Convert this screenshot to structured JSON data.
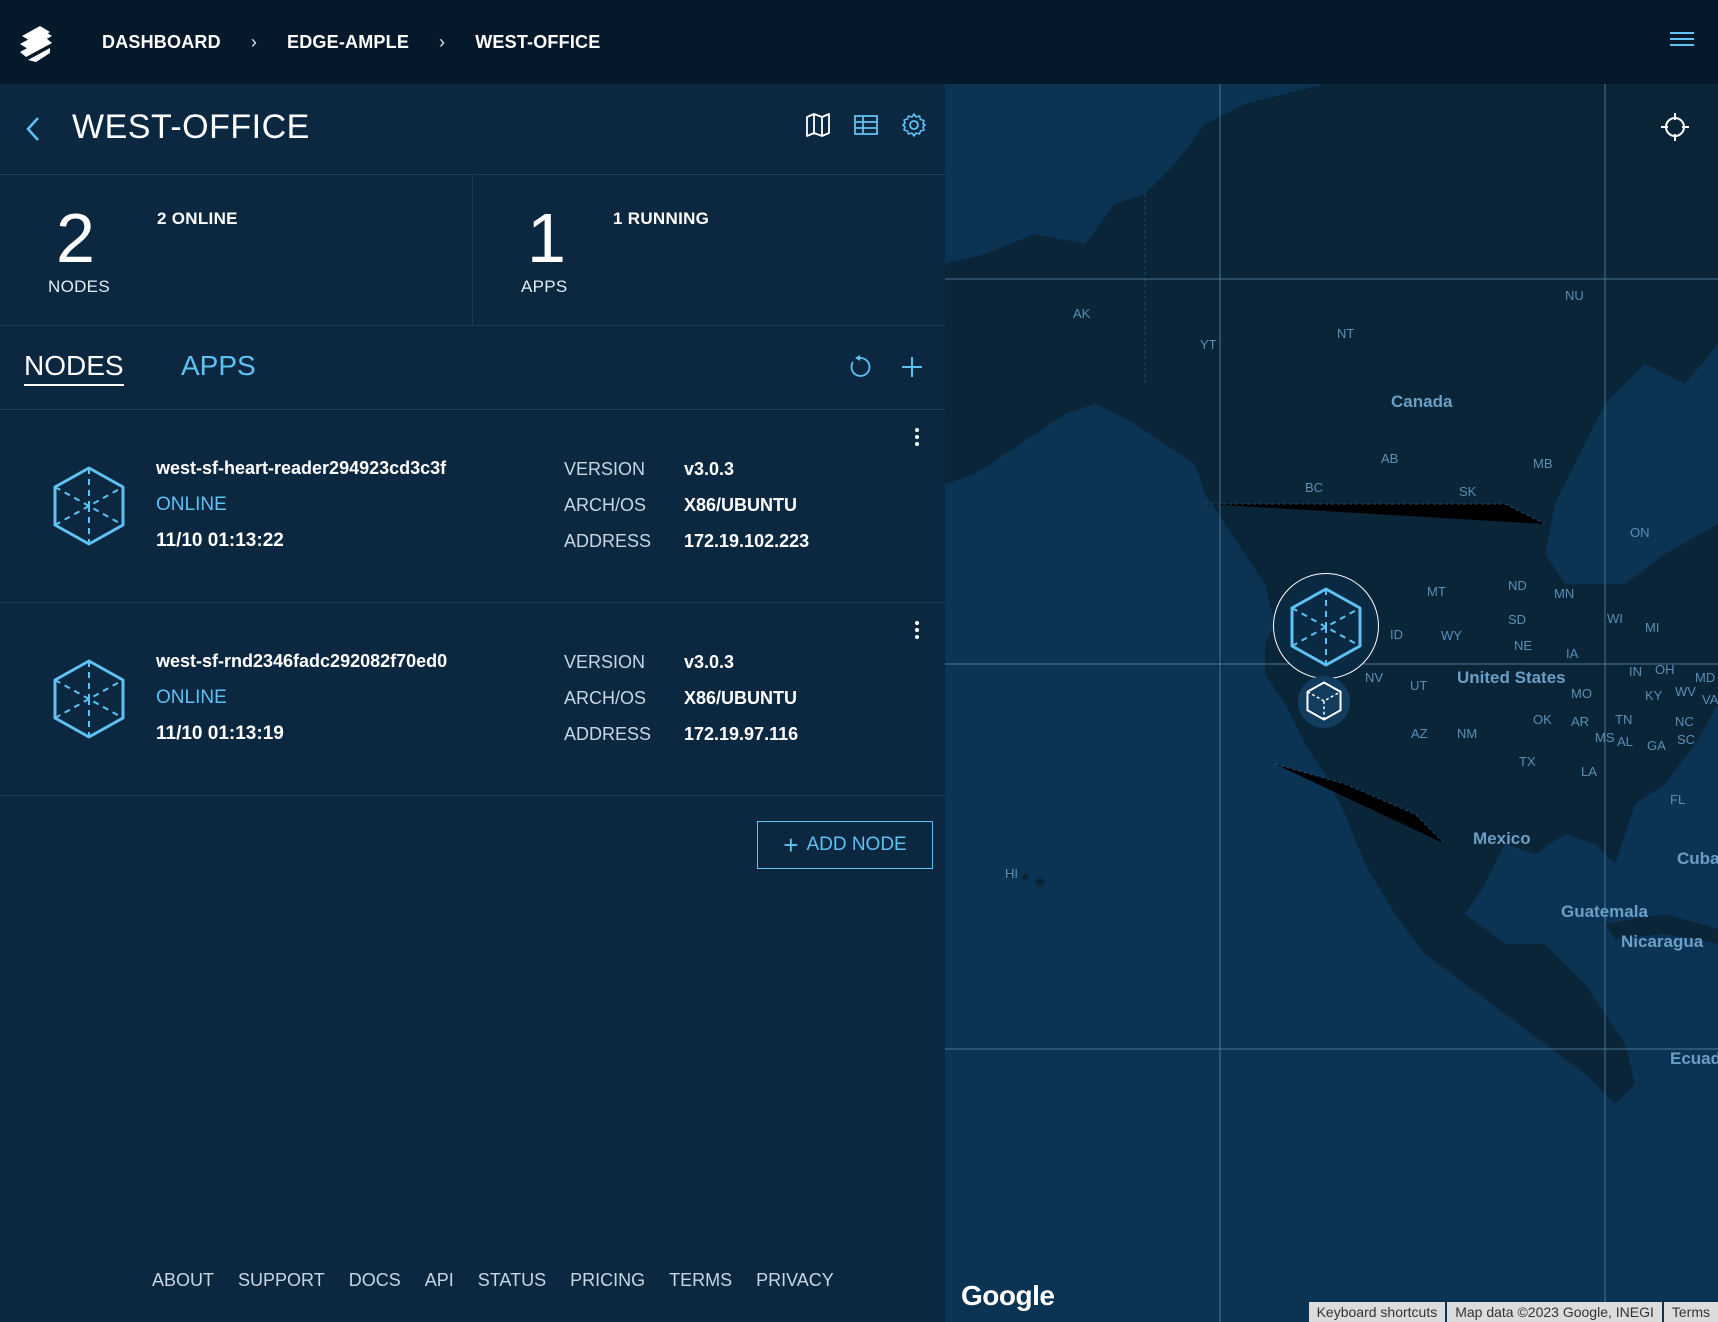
{
  "breadcrumb": [
    "DASHBOARD",
    "EDGE-AMPLE",
    "WEST-OFFICE"
  ],
  "header": {
    "title": "WEST-OFFICE"
  },
  "stats": {
    "nodes": {
      "count": "2",
      "label": "NODES",
      "sub": "2 ONLINE"
    },
    "apps": {
      "count": "1",
      "label": "APPS",
      "sub": "1 RUNNING"
    }
  },
  "tabs": {
    "nodes": "NODES",
    "apps": "APPS"
  },
  "nodes": [
    {
      "name": "west-sf-heart-reader294923cd3c3f",
      "status": "ONLINE",
      "time": "11/10 01:13:22",
      "version_label": "VERSION",
      "version": "v3.0.3",
      "arch_label": "ARCH/OS",
      "arch": "X86/UBUNTU",
      "address_label": "ADDRESS",
      "address": "172.19.102.223"
    },
    {
      "name": "west-sf-rnd2346fadc292082f70ed0",
      "status": "ONLINE",
      "time": "11/10 01:13:19",
      "version_label": "VERSION",
      "version": "v3.0.3",
      "arch_label": "ARCH/OS",
      "arch": "X86/UBUNTU",
      "address_label": "ADDRESS",
      "address": "172.19.97.116"
    }
  ],
  "add_node": "ADD NODE",
  "footer": [
    "ABOUT",
    "SUPPORT",
    "DOCS",
    "API",
    "STATUS",
    "PRICING",
    "TERMS",
    "PRIVACY"
  ],
  "map": {
    "labels": {
      "canada": "Canada",
      "us": "United States",
      "mexico": "Mexico",
      "cuba": "Cuba",
      "guatemala": "Guatemala",
      "nicaragua": "Nicaragua",
      "ecuador": "Ecuad",
      "ak": "AK",
      "yt": "YT",
      "nt": "NT",
      "nu": "NU",
      "bc": "BC",
      "ab": "AB",
      "sk": "SK",
      "mb": "MB",
      "on": "ON",
      "mt": "MT",
      "nd": "ND",
      "mn": "MN",
      "wi": "WI",
      "mi": "MI",
      "sd": "SD",
      "wy": "WY",
      "id": "ID",
      "ne": "NE",
      "ia": "IA",
      "nv": "NV",
      "ut": "UT",
      "in": "IN",
      "oh": "OH",
      "md": "MD",
      "mo": "MO",
      "ky": "KY",
      "wv": "WV",
      "va": "VA",
      "ok": "OK",
      "ar": "AR",
      "tn": "TN",
      "nc": "NC",
      "az": "AZ",
      "nm": "NM",
      "ms": "MS",
      "al": "AL",
      "ga": "GA",
      "sc": "SC",
      "tx": "TX",
      "la": "LA",
      "fl": "FL",
      "hi": "HI"
    },
    "google": "Google",
    "attribution": [
      "Keyboard shortcuts",
      "Map data ©2023 Google, INEGI",
      "Terms"
    ]
  },
  "colors": {
    "accent": "#5fc2f5",
    "topbar": "#05192b",
    "panel": "#0c2740",
    "map_water": "#0b3354",
    "map_land": "#0a2438"
  }
}
